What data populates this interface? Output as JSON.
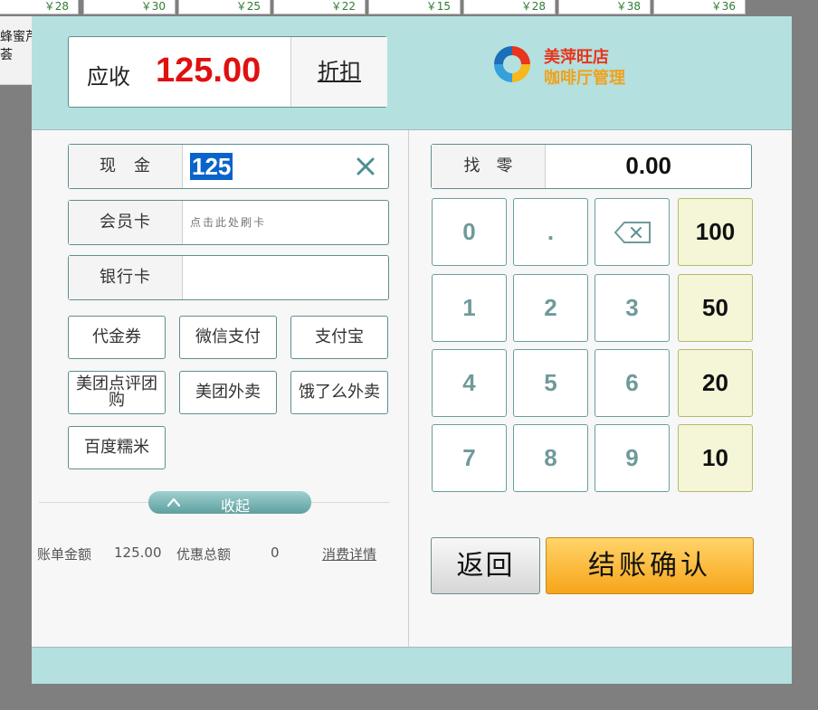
{
  "background": {
    "tiles": [
      "￥28",
      "￥30",
      "￥25",
      "￥22",
      "￥15",
      "￥28",
      "￥38",
      "￥36"
    ],
    "left_text_1": "蜂蜜芦",
    "left_text_2": "荟"
  },
  "header": {
    "due_label": "应收",
    "due_amount": "125.00",
    "discount_label": "折扣",
    "logo_line1": "美萍旺店",
    "logo_line2": "咖啡厅管理"
  },
  "payments": {
    "cash_label": "现　金",
    "cash_value": "125",
    "member_label": "会员卡",
    "member_placeholder": "点击此处刷卡",
    "bank_label": "银行卡",
    "bank_value": ""
  },
  "methods": {
    "voucher": "代金券",
    "wechat": "微信支付",
    "alipay": "支付宝",
    "meituan_group": "美团点评团购",
    "meituan_takeout": "美团外卖",
    "eleme": "饿了么外卖",
    "baidu": "百度糯米"
  },
  "collapse": {
    "label": "收起"
  },
  "summary": {
    "bill_label": "账单金额",
    "bill_value": "125.00",
    "discount_label": "优惠总额",
    "discount_value": "0",
    "detail_link": "消费详情"
  },
  "change": {
    "label": "找　零",
    "value": "0.00"
  },
  "keypad": {
    "row1": [
      "0",
      "."
    ],
    "row2": [
      "1",
      "2",
      "3"
    ],
    "row3": [
      "4",
      "5",
      "6"
    ],
    "row4": [
      "7",
      "8",
      "9"
    ],
    "quick": [
      "100",
      "50",
      "20",
      "10"
    ]
  },
  "actions": {
    "back": "返回",
    "confirm": "结账确认"
  },
  "colors": {
    "header_bg": "#b4e0e0",
    "due_amount": "#e01010",
    "selection": "#0a63c9",
    "confirm_gradient_top": "#ffd46a",
    "confirm_gradient_bottom": "#f7a51a",
    "quick_key_bg": "#f5f5d8"
  }
}
